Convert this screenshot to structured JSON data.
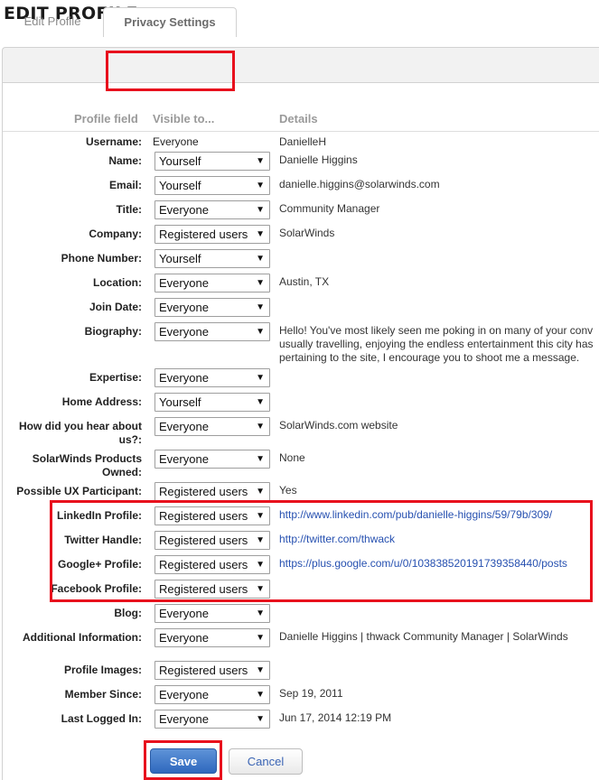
{
  "page": {
    "title": "EDIT PROFILE"
  },
  "tabs": [
    {
      "label": "Edit Profile"
    },
    {
      "label": "Privacy Settings",
      "active": true
    }
  ],
  "columns": {
    "field": "Profile field",
    "visible": "Visible to...",
    "details": "Details"
  },
  "rows": [
    {
      "label": "Username:",
      "visibility": "Everyone",
      "fixed": true,
      "details": [
        "DanielleH"
      ]
    },
    {
      "label": "Name:",
      "visibility": "Yourself",
      "details": [
        "Danielle Higgins"
      ]
    },
    {
      "label": "Email:",
      "visibility": "Yourself",
      "details": [
        "danielle.higgins@solarwinds.com"
      ]
    },
    {
      "label": "Title:",
      "visibility": "Everyone",
      "details": [
        "Community Manager"
      ]
    },
    {
      "label": "Company:",
      "visibility": "Registered users",
      "details": [
        "SolarWinds"
      ]
    },
    {
      "label": "Phone Number:",
      "visibility": "Yourself",
      "details": []
    },
    {
      "label": "Location:",
      "visibility": "Everyone",
      "details": [
        "Austin, TX"
      ]
    },
    {
      "label": "Join Date:",
      "visibility": "Everyone",
      "details": []
    },
    {
      "label": "Biography:",
      "visibility": "Everyone",
      "details": [
        "Hello! You've most likely seen me poking in on many of your conv",
        "usually travelling, enjoying the endless entertainment this city has",
        "pertaining to the site, I encourage you to shoot me a message."
      ]
    },
    {
      "label": "Expertise:",
      "visibility": "Everyone",
      "details": []
    },
    {
      "label": "Home Address:",
      "visibility": "Yourself",
      "details": []
    },
    {
      "label": [
        "How did you hear about",
        "us?:"
      ],
      "visibility": "Everyone",
      "details": [
        "SolarWinds.com website"
      ]
    },
    {
      "label": [
        "SolarWinds Products",
        "Owned:"
      ],
      "visibility": "Everyone",
      "details": [
        "None"
      ]
    },
    {
      "label": "Possible UX Participant:",
      "visibility": "Registered users",
      "details": [
        "Yes"
      ]
    },
    {
      "label": "LinkedIn Profile:",
      "visibility": "Registered users",
      "details": [
        "http://www.linkedin.com/pub/danielle-higgins/59/79b/309/"
      ],
      "link": true
    },
    {
      "label": "Twitter Handle:",
      "visibility": "Registered users",
      "details": [
        "http://twitter.com/thwack"
      ],
      "link": true
    },
    {
      "label": "Google+ Profile:",
      "visibility": "Registered users",
      "details": [
        "https://plus.google.com/u/0/103838520191739358440/posts"
      ],
      "link": true
    },
    {
      "label": "Facebook Profile:",
      "visibility": "Registered users",
      "details": []
    },
    {
      "label": "Blog:",
      "visibility": "Everyone",
      "details": []
    },
    {
      "label": "Additional Information:",
      "visibility": "Everyone",
      "details": [
        "Danielle Higgins | thwack Community Manager | SolarWinds"
      ]
    },
    {
      "label": "Profile Images:",
      "visibility": "Registered users",
      "details": []
    },
    {
      "label": "Member Since:",
      "visibility": "Everyone",
      "details": [
        "Sep 19, 2011"
      ]
    },
    {
      "label": "Last Logged In:",
      "visibility": "Everyone",
      "details": [
        "Jun 17, 2014 12:19 PM"
      ]
    }
  ],
  "buttons": {
    "save": "Save",
    "cancel": "Cancel"
  },
  "colors": {
    "highlight": "#e8101d",
    "link": "#2650b0",
    "save": "#2f68bd"
  }
}
